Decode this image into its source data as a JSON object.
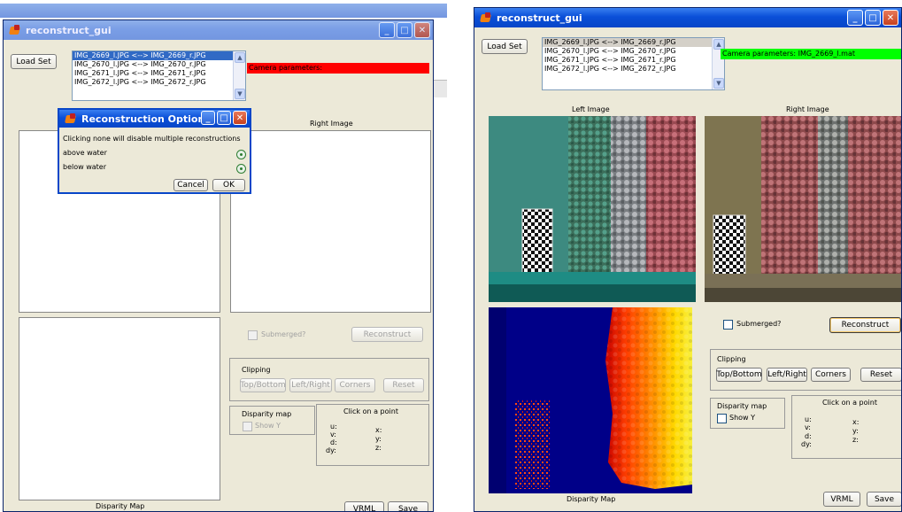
{
  "colors": {
    "status_error": "#ff0000",
    "status_ok": "#00ff00",
    "window_bg": "#ece9d8",
    "titlebar_blue": "#0a4fd8",
    "list_selection": "#316ac5"
  },
  "left_window": {
    "title": "reconstruct_gui",
    "load_set_label": "Load Set",
    "image_pairs": [
      "IMG_2669_l.JPG <--> IMG_2669_r.JPG",
      "IMG_2670_l.JPG <--> IMG_2670_r.JPG",
      "IMG_2671_l.JPG <--> IMG_2671_r.JPG",
      "IMG_2672_l.JPG <--> IMG_2672_r.JPG"
    ],
    "selected_pair_index": 0,
    "status_text": "Camera parameters:",
    "right_image_label": "Right Image",
    "disparity_map_label": "Disparity Map",
    "submerged_label": "Submerged?",
    "reconstruct_label": "Reconstruct",
    "clipping_title": "Clipping",
    "clip_buttons": [
      "Top/Bottom",
      "Left/Right",
      "Corners",
      "Reset"
    ],
    "disparity_panel_title": "Disparity map",
    "show_y_label": "Show Y",
    "click_point_title": "Click on a point",
    "point_labels_left": [
      "u:",
      "v:",
      "d:",
      "dy:"
    ],
    "point_labels_right": [
      "x:",
      "y:",
      "z:"
    ],
    "vrml_label": "VRML",
    "save_label": "Save"
  },
  "dialog": {
    "title": "Reconstruction Options",
    "message": "Clicking none will disable multiple reconstructions",
    "option_above": "above water",
    "option_below": "below water",
    "cancel_label": "Cancel",
    "ok_label": "OK"
  },
  "right_window": {
    "title": "reconstruct_gui",
    "load_set_label": "Load Set",
    "image_pairs": [
      "IMG_2669_l.JPG <--> IMG_2669_r.JPG",
      "IMG_2670_l.JPG <--> IMG_2670_r.JPG",
      "IMG_2671_l.JPG <--> IMG_2671_r.JPG",
      "IMG_2672_l.JPG <--> IMG_2672_r.JPG"
    ],
    "selected_pair_index": 0,
    "status_text": "Camera parameters: IMG_2669_l.mat",
    "left_image_label": "Left Image",
    "right_image_label": "Right Image",
    "disparity_map_label": "Disparity Map",
    "submerged_label": "Submerged?",
    "reconstruct_label": "Reconstruct",
    "clipping_title": "Clipping",
    "clip_buttons": [
      "Top/Bottom",
      "Left/Right",
      "Corners",
      "Reset"
    ],
    "disparity_panel_title": "Disparity map",
    "show_y_label": "Show Y",
    "click_point_title": "Click on a point",
    "point_labels_left": [
      "u:",
      "v:",
      "d:",
      "dy:"
    ],
    "point_labels_right": [
      "x:",
      "y:",
      "z:"
    ],
    "vrml_label": "VRML",
    "save_label": "Save"
  }
}
